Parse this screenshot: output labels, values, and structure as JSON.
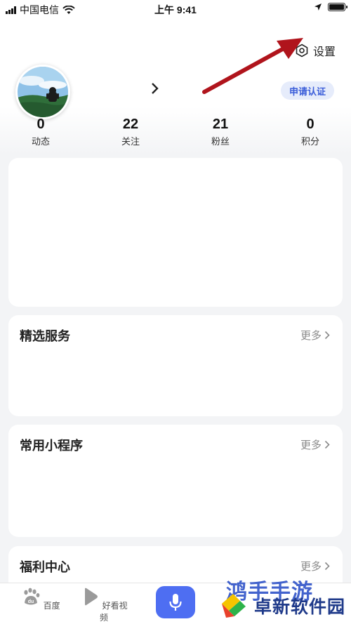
{
  "status_bar": {
    "carrier": "中国电信",
    "time": "上午 9:41",
    "battery_level": 1.0
  },
  "header": {
    "settings_label": "设置",
    "certify_label": "申请认证"
  },
  "stats": [
    {
      "value": "0",
      "label": "动态"
    },
    {
      "value": "22",
      "label": "关注"
    },
    {
      "value": "21",
      "label": "粉丝"
    },
    {
      "value": "0",
      "label": "积分"
    }
  ],
  "sections": {
    "featured": {
      "title": "精选服务",
      "more": "更多"
    },
    "mini_programs": {
      "title": "常用小程序",
      "more": "更多"
    },
    "welfare": {
      "title": "福利中心",
      "more": "更多"
    }
  },
  "bottom_nav": {
    "home_label": "百度",
    "video_label": "好看视频"
  },
  "watermark": {
    "top_text": "鸿手手游",
    "brand_text": "卓新软件园"
  },
  "colors": {
    "accent": "#4e6ef2",
    "certify_bg": "#e6ecfb",
    "certify_text": "#3a5dd9",
    "annotation_arrow": "#b0141c"
  },
  "icons": {
    "settings": "hexagon-gear-icon",
    "profile": "chevron-right-icon",
    "home": "baidu-paw-icon",
    "video": "play-icon",
    "voice": "microphone-icon"
  }
}
